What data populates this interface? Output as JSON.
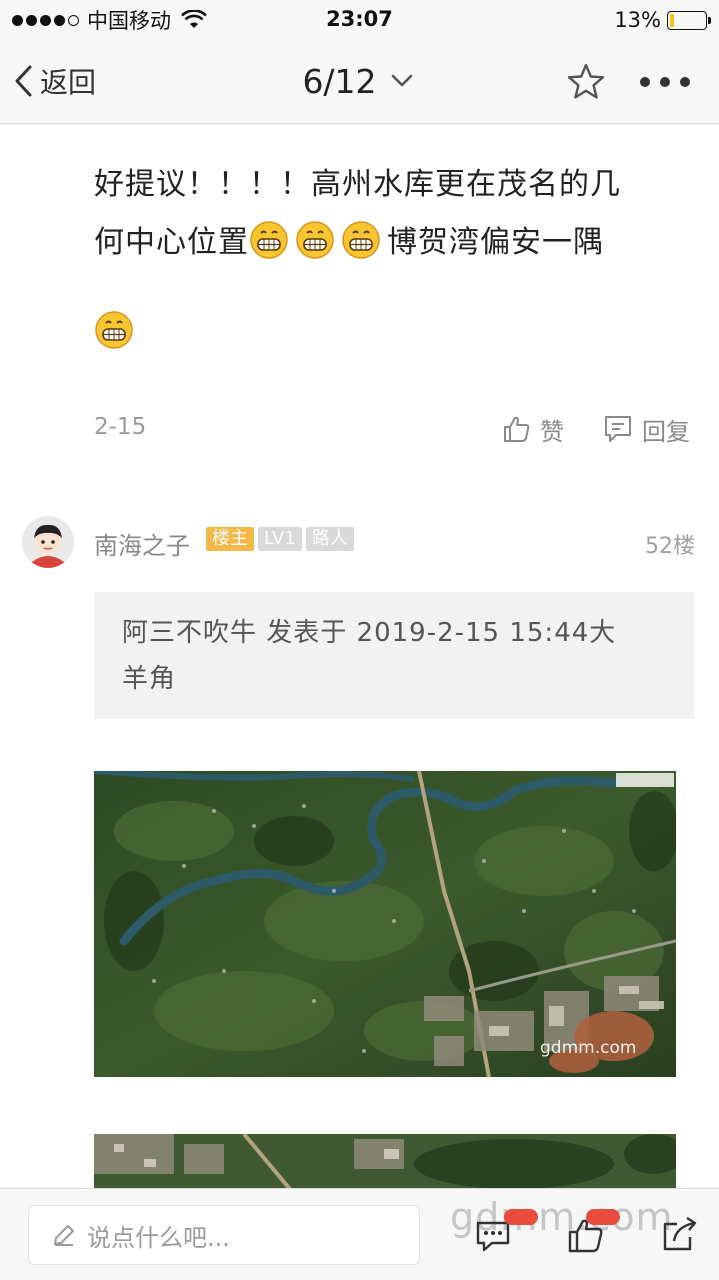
{
  "status_bar": {
    "carrier": "中国移动",
    "time": "23:07",
    "battery_percent": "13%",
    "battery_level": 0.13
  },
  "nav": {
    "back_label": "返回",
    "page_indicator": "6/12"
  },
  "post": {
    "text_line1": "好提议！！！！高州水库更在茂名的几",
    "text_line2": "何中心位置",
    "text_line2_tail": "博贺湾偏安一隅",
    "date": "2-15",
    "like_label": "赞",
    "reply_label": "回复"
  },
  "reply": {
    "username": "南海之子",
    "badge_host": "楼主",
    "badge_level": "LV1",
    "badge_role": "路人",
    "floor": "52楼",
    "quote_line1": "阿三不吹牛 发表于 2019-2-15 15:44大",
    "quote_line2": "羊角",
    "image_watermark": "gdmm.com"
  },
  "bottom_bar": {
    "comment_placeholder": "说点什么吧...",
    "watermark": "gdmm.com"
  },
  "colors": {
    "background": "#ffffff",
    "bar_background": "#f7f7f7",
    "host_badge": "#f5b94a",
    "notification_badge": "#e94b3c",
    "battery_fill": "#f5c21b"
  }
}
